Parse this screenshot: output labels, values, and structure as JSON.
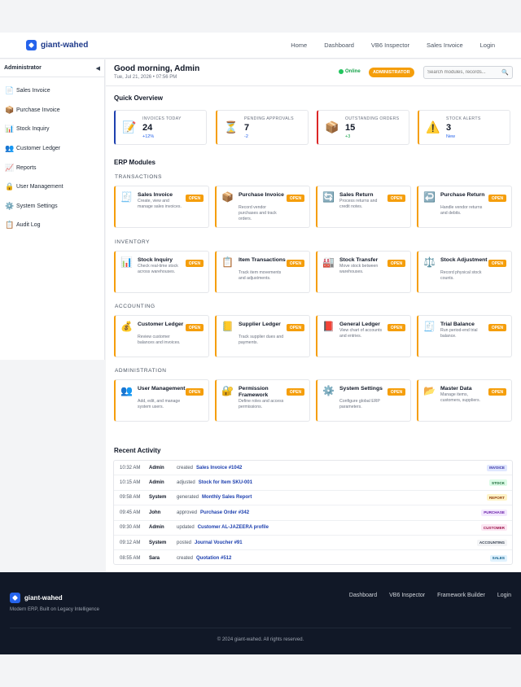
{
  "brand": {
    "name": "giant-wahed"
  },
  "nav": {
    "links": [
      "Home",
      "Dashboard",
      "VB6 Inspector",
      "Sales Invoice",
      "Login"
    ]
  },
  "sidebar": {
    "title": "Administrator",
    "toggle": "◀",
    "items": [
      {
        "label": "Sales Invoice",
        "icon": "📄"
      },
      {
        "label": "Purchase Invoice",
        "icon": "📦"
      },
      {
        "label": "Stock Inquiry",
        "icon": "📊"
      },
      {
        "label": "Customer Ledger",
        "icon": "👥"
      },
      {
        "label": "Reports",
        "icon": "📈"
      },
      {
        "label": "User Management",
        "icon": "🔒"
      },
      {
        "label": "System Settings",
        "icon": "⚙️"
      },
      {
        "label": "Audit Log",
        "icon": "📋"
      }
    ]
  },
  "header": {
    "greeting": "Good morning, Admin",
    "date": "Tue, Jul 21, 2026 • 07:56 PM",
    "status": "Online",
    "role_badge": "ADMINISTRATOR",
    "search_placeholder": "Search modules, records...",
    "search_icon": "🔍"
  },
  "overview": {
    "title": "Quick Overview",
    "stats": [
      {
        "label": "INVOICES TODAY",
        "value": "24",
        "delta": "+12%",
        "icon": "📝",
        "color": "#1e40af",
        "delta_color": "#2563eb"
      },
      {
        "label": "PENDING APPROVALS",
        "value": "7",
        "delta": "-2",
        "icon": "⏳",
        "color": "#f59e0b",
        "delta_color": "#2563eb"
      },
      {
        "label": "OUTSTANDING ORDERS",
        "value": "15",
        "delta": "+3",
        "icon": "📦",
        "color": "#dc2626",
        "delta_color": "#16a34a"
      },
      {
        "label": "STOCK ALERTS",
        "value": "3",
        "delta": "New",
        "icon": "⚠️",
        "color": "#f59e0b",
        "delta_color": "#2563eb"
      }
    ]
  },
  "modules": {
    "title": "ERP Modules",
    "open_label": "OPEN",
    "groups": [
      {
        "title": "TRANSACTIONS",
        "items": [
          {
            "name": "Sales Invoice",
            "desc": "Create, view and manage sales invoices.",
            "icon": "🧾"
          },
          {
            "name": "Purchase Invoice",
            "desc": "Record vendor purchases and track orders.",
            "icon": "📦"
          },
          {
            "name": "Sales Return",
            "desc": "Process returns and credit notes.",
            "icon": "🔄"
          },
          {
            "name": "Purchase Return",
            "desc": "Handle vendor returns and debits.",
            "icon": "↩️"
          }
        ]
      },
      {
        "title": "INVENTORY",
        "items": [
          {
            "name": "Stock Inquiry",
            "desc": "Check real-time stock across warehouses.",
            "icon": "📊"
          },
          {
            "name": "Item Transactions",
            "desc": "Track item movements and adjustments.",
            "icon": "📋"
          },
          {
            "name": "Stock Transfer",
            "desc": "Move stock between warehouses.",
            "icon": "🏭"
          },
          {
            "name": "Stock Adjustment",
            "desc": "Record physical stock counts.",
            "icon": "⚖️"
          }
        ]
      },
      {
        "title": "ACCOUNTING",
        "items": [
          {
            "name": "Customer Ledger",
            "desc": "Review customer balances and invoices.",
            "icon": "💰"
          },
          {
            "name": "Supplier Ledger",
            "desc": "Track supplier dues and payments.",
            "icon": "📒"
          },
          {
            "name": "General Ledger",
            "desc": "View chart of accounts and entries.",
            "icon": "📕"
          },
          {
            "name": "Trial Balance",
            "desc": "Run period-end trial balance.",
            "icon": "🧾"
          }
        ]
      },
      {
        "title": "ADMINISTRATION",
        "items": [
          {
            "name": "User Management",
            "desc": "Add, edit, and manage system users.",
            "icon": "👥"
          },
          {
            "name": "Permission Framework",
            "desc": "Define roles and access permissions.",
            "icon": "🔐"
          },
          {
            "name": "System Settings",
            "desc": "Configure global ERP parameters.",
            "icon": "⚙️"
          },
          {
            "name": "Master Data",
            "desc": "Manage items, customers, suppliers.",
            "icon": "📂"
          }
        ]
      }
    ]
  },
  "activity": {
    "title": "Recent Activity",
    "rows": [
      {
        "time": "10:32 AM",
        "user": "Admin",
        "action": "created",
        "ref": "Sales Invoice #1042",
        "badge": "INVOICE",
        "bg": "#e0e7ff",
        "fg": "#3730a3"
      },
      {
        "time": "10:15 AM",
        "user": "Admin",
        "action": "adjusted",
        "ref": "Stock for Item SKU-001",
        "badge": "STOCK",
        "bg": "#dcfce7",
        "fg": "#166534"
      },
      {
        "time": "09:58 AM",
        "user": "System",
        "action": "generated",
        "ref": "Monthly Sales Report",
        "badge": "REPORT",
        "bg": "#fef3c7",
        "fg": "#92400e"
      },
      {
        "time": "09:45 AM",
        "user": "John",
        "action": "approved",
        "ref": "Purchase Order #342",
        "badge": "PURCHASE",
        "bg": "#f3e8ff",
        "fg": "#6b21a8"
      },
      {
        "time": "09:30 AM",
        "user": "Admin",
        "action": "updated",
        "ref": "Customer AL-JAZEERA profile",
        "badge": "CUSTOMER",
        "bg": "#fce7f3",
        "fg": "#9d174d"
      },
      {
        "time": "09:12 AM",
        "user": "System",
        "action": "posted",
        "ref": "Journal Voucher #91",
        "badge": "ACCOUNTING",
        "bg": "#f3f4f6",
        "fg": "#374151"
      },
      {
        "time": "08:55 AM",
        "user": "Sara",
        "action": "created",
        "ref": "Quotation #512",
        "badge": "SALES",
        "bg": "#e0f2fe",
        "fg": "#075985"
      }
    ]
  },
  "footer": {
    "brand": "giant-wahed",
    "tagline": "Modern ERP, Built on Legacy Intelligence",
    "links": [
      "Dashboard",
      "VB6 Inspector",
      "Framework Builder",
      "Login"
    ],
    "copyright": "© 2024 giant-wahed. All rights reserved."
  }
}
